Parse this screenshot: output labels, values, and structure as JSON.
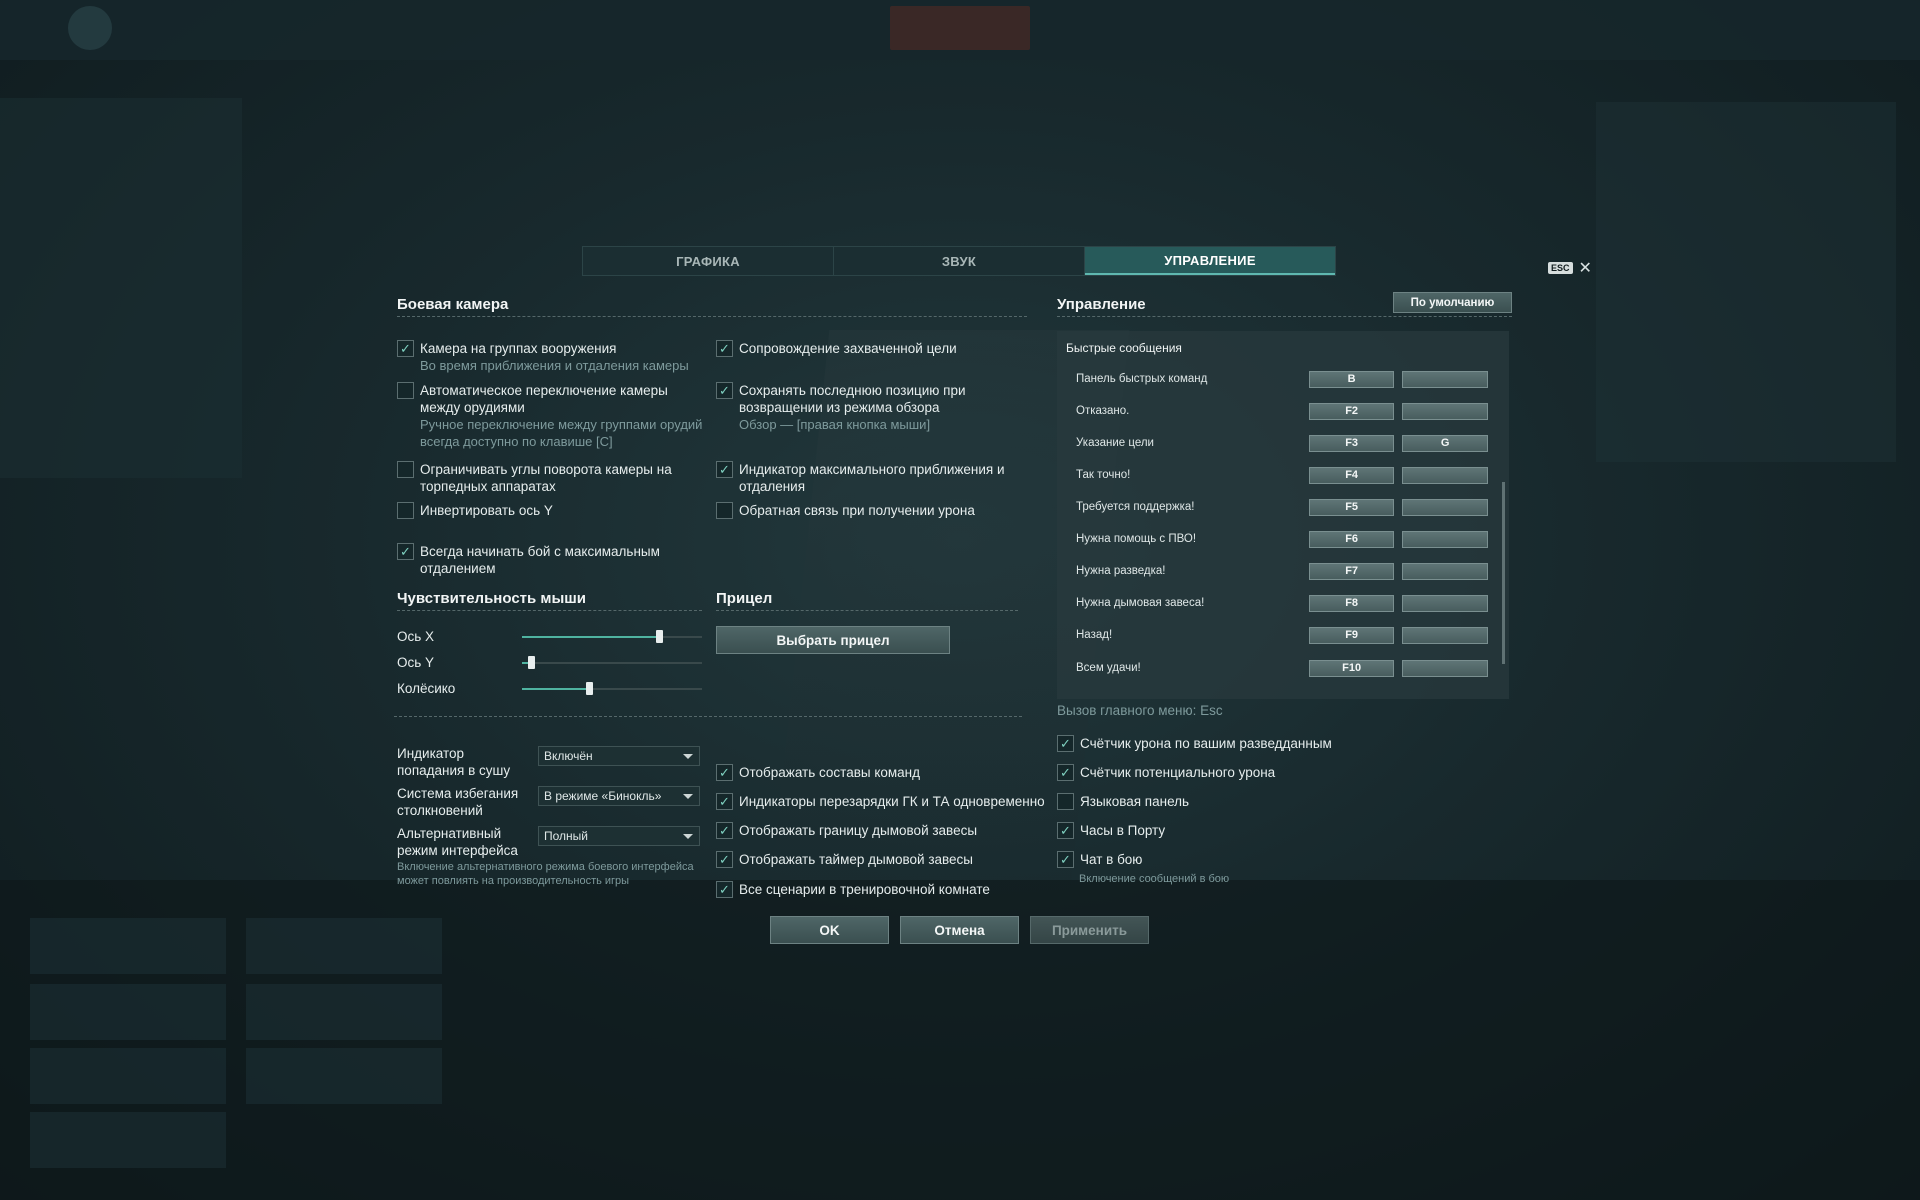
{
  "tabs": [
    {
      "label": "ГРАФИКА",
      "active": false
    },
    {
      "label": "ЗВУК",
      "active": false
    },
    {
      "label": "УПРАВЛЕНИЕ",
      "active": true
    }
  ],
  "esc_label": "ESC",
  "close_glyph": "✕",
  "check_glyph": "✓",
  "camera": {
    "title": "Боевая камера",
    "left": [
      {
        "label": "Камера на группах вооружения",
        "sub": "Во время приближения и отдаления камеры",
        "checked": true
      },
      {
        "label": "Автоматическое переключение камеры между орудиями",
        "sub": "Ручное переключение между группами орудий всегда доступно по клавише [C]",
        "checked": false
      },
      {
        "label": "Ограничивать углы поворота камеры на торпедных аппаратах",
        "sub": "",
        "checked": false
      },
      {
        "label": "Инвертировать ось Y",
        "sub": "",
        "checked": false
      },
      {
        "label": "Всегда начинать бой с максимальным отдалением",
        "sub": "",
        "checked": true
      }
    ],
    "right": [
      {
        "label": "Сопровождение захваченной цели",
        "sub": "",
        "checked": true
      },
      {
        "label": "Сохранять последнюю позицию при возвращении из режима обзора",
        "sub": "Обзор — [правая кнопка мыши]",
        "checked": true
      },
      {
        "label": "Индикатор максимального приближения и отдаления",
        "sub": "",
        "checked": true
      },
      {
        "label": "Обратная связь при получении урона",
        "sub": "",
        "checked": false
      }
    ]
  },
  "mouse": {
    "title": "Чувствительность мыши",
    "sliders": [
      {
        "label": "Ось X",
        "value": 0.76
      },
      {
        "label": "Ось Y",
        "value": 0.05
      },
      {
        "label": "Колёсико",
        "value": 0.37
      }
    ]
  },
  "sight": {
    "title": "Прицел",
    "button": "Выбрать прицел"
  },
  "dropdowns": [
    {
      "label": "Индикатор попадания в сушу",
      "value": "Включён"
    },
    {
      "label": "Система избегания столкновений",
      "value": "В режиме «Бинокль»"
    },
    {
      "label": "Альтернативный режим интерфейса",
      "value": "Полный"
    }
  ],
  "interface_hint": "Включение альтернативного режима боевого интерфейса может повлиять на производительность игры",
  "display_options": [
    {
      "label": "Отображать составы команд",
      "checked": true
    },
    {
      "label": "Индикаторы перезарядки ГК и ТА одновременно",
      "checked": true
    },
    {
      "label": "Отображать границу дымовой завесы",
      "checked": true
    },
    {
      "label": "Отображать таймер дымовой завесы",
      "checked": true
    },
    {
      "label": "Все сценарии в тренировочной комнате",
      "checked": true
    }
  ],
  "controls": {
    "title": "Управление",
    "defaults_button": "По умолчанию",
    "panel_title": "Быстрые сообщения",
    "bindings": [
      {
        "name": "Панель быстрых команд",
        "key1": "B",
        "key2": ""
      },
      {
        "name": "Отказано.",
        "key1": "F2",
        "key2": ""
      },
      {
        "name": "Указание цели",
        "key1": "F3",
        "key2": "G"
      },
      {
        "name": "Так точно!",
        "key1": "F4",
        "key2": ""
      },
      {
        "name": "Требуется поддержка!",
        "key1": "F5",
        "key2": ""
      },
      {
        "name": "Нужна помощь с ПВО!",
        "key1": "F6",
        "key2": ""
      },
      {
        "name": "Нужна разведка!",
        "key1": "F7",
        "key2": ""
      },
      {
        "name": "Нужна дымовая завеса!",
        "key1": "F8",
        "key2": ""
      },
      {
        "name": "Назад!",
        "key1": "F9",
        "key2": ""
      },
      {
        "name": "Всем удачи!",
        "key1": "F10",
        "key2": ""
      }
    ],
    "menu_hint": "Вызов главного меню: Esc",
    "options": [
      {
        "label": "Счётчик урона по вашим разведданным",
        "checked": true
      },
      {
        "label": "Счётчик потенциального урона",
        "checked": true
      },
      {
        "label": "Языковая панель",
        "checked": false
      },
      {
        "label": "Часы в Порту",
        "checked": true
      },
      {
        "label": "Чат в бою",
        "checked": true
      }
    ],
    "chat_hint": "Включение сообщений в бою"
  },
  "footer": {
    "ok": "OK",
    "cancel": "Отмена",
    "apply": "Применить"
  }
}
